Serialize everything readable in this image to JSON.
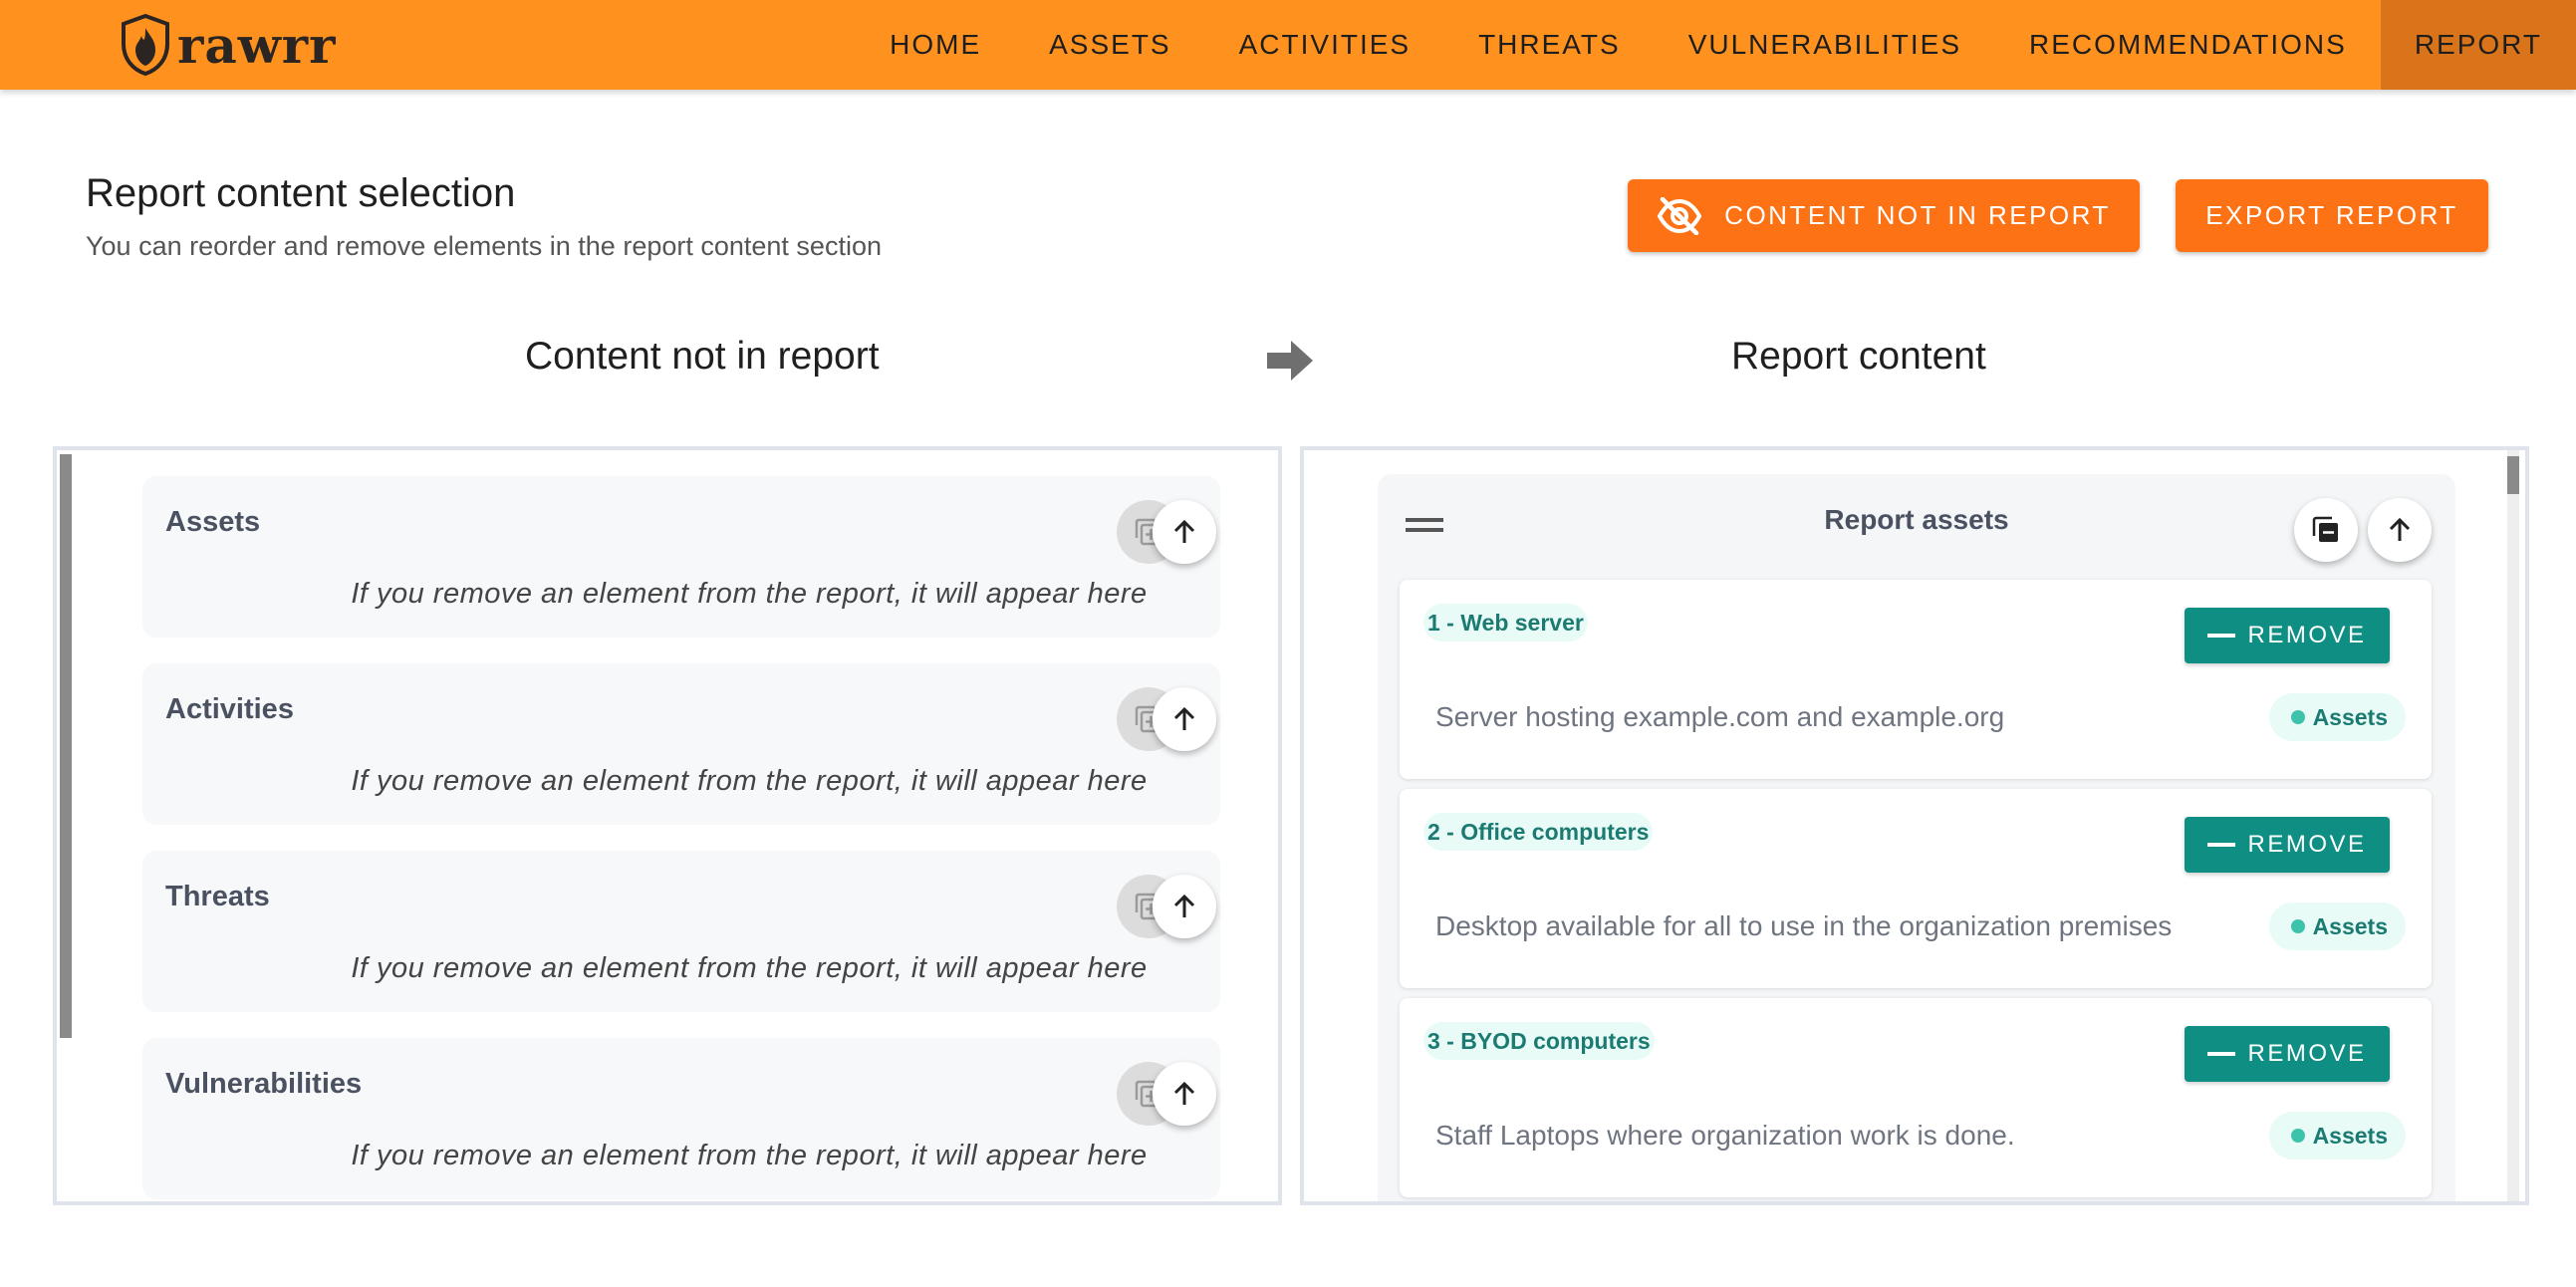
{
  "app": {
    "name": "rawrr"
  },
  "nav": {
    "items": [
      {
        "label": "HOME",
        "active": false
      },
      {
        "label": "ASSETS",
        "active": false
      },
      {
        "label": "ACTIVITIES",
        "active": false
      },
      {
        "label": "THREATS",
        "active": false
      },
      {
        "label": "VULNERABILITIES",
        "active": false
      },
      {
        "label": "RECOMMENDATIONS",
        "active": false
      },
      {
        "label": "REPORT",
        "active": true
      }
    ]
  },
  "header": {
    "title": "Report content selection",
    "subtitle": "You can reorder and remove elements in the report content section",
    "content_not_in_report_label": "CONTENT NOT IN REPORT",
    "export_report_label": "EXPORT REPORT"
  },
  "columns": {
    "left_title": "Content not in report",
    "right_title": "Report content"
  },
  "not_in_report": {
    "sections": [
      {
        "title": "Assets",
        "empty_text": "If you remove an element from the report, it will appear here"
      },
      {
        "title": "Activities",
        "empty_text": "If you remove an element from the report, it will appear here"
      },
      {
        "title": "Threats",
        "empty_text": "If you remove an element from the report, it will appear here"
      },
      {
        "title": "Vulnerabilities",
        "empty_text": "If you remove an element from the report, it will appear here"
      }
    ]
  },
  "report": {
    "section_title": "Report assets",
    "items": [
      {
        "tag": "1 - Web server",
        "remove_label": "REMOVE",
        "description": "Server hosting example.com and example.org",
        "badge": "Assets"
      },
      {
        "tag": "2 - Office computers",
        "remove_label": "REMOVE",
        "description": "Desktop available for all to use in the organization premises",
        "badge": "Assets"
      },
      {
        "tag": "3 - BYOD computers",
        "remove_label": "REMOVE",
        "description": "Staff Laptops where organization work is done.",
        "badge": "Assets"
      }
    ]
  },
  "colors": {
    "navbar": "#ff911f",
    "nav_active": "#d9741a",
    "button_orange": "#fd7214",
    "remove_teal": "#0f8f84",
    "tag_bg": "#e8fbf6"
  },
  "icons": [
    "shield-logo-icon",
    "eye-off-icon",
    "arrow-right-icon",
    "copy-add-icon",
    "arrow-up-icon",
    "drag-handle-icon",
    "copy-icon"
  ]
}
